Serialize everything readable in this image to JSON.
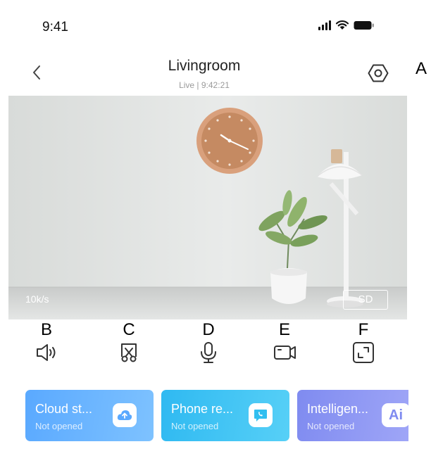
{
  "status_bar": {
    "time": "9:41"
  },
  "header": {
    "title": "Livingroom",
    "subtitle": "Live | 9:42:21",
    "settings_marker": "A"
  },
  "video": {
    "bitrate": "10k/s",
    "quality_label": "SD"
  },
  "controls": [
    {
      "marker": "B",
      "icon": "speaker-icon"
    },
    {
      "marker": "C",
      "icon": "screenshot-scissors-icon"
    },
    {
      "marker": "D",
      "icon": "microphone-icon"
    },
    {
      "marker": "E",
      "icon": "video-record-icon"
    },
    {
      "marker": "F",
      "icon": "fullscreen-icon"
    }
  ],
  "feature_cards": [
    {
      "title": "Cloud st...",
      "status": "Not opened",
      "icon": "cloud-upload-icon",
      "color": "#5aa9ff"
    },
    {
      "title": "Phone re...",
      "status": "Not opened",
      "icon": "phone-chat-icon",
      "color": "#32bff0"
    },
    {
      "title": "Intelligen...",
      "status": "Not opened",
      "icon": "ai-icon",
      "icon_text": "Ai",
      "color": "#8b8ff4"
    }
  ]
}
